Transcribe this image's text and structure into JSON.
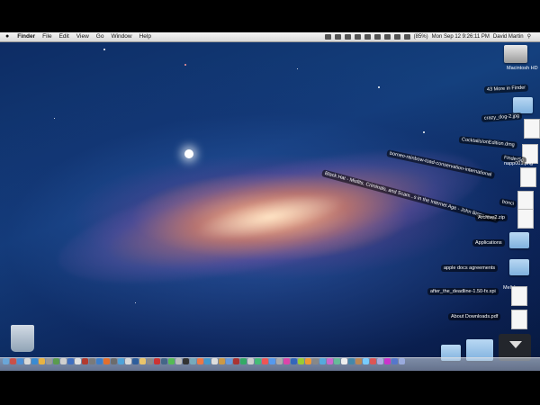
{
  "menubar": {
    "apple": "",
    "items": [
      "Finder",
      "File",
      "Edit",
      "View",
      "Go",
      "Window",
      "Help"
    ],
    "battery": "(85%)",
    "clock": "Mon Sep 12  9:26:11 PM",
    "user": "David Martin"
  },
  "desktop": {
    "disk_label": "Macintosh HD"
  },
  "downloads_stack": {
    "header": "43 More in Finder",
    "items": [
      "crazy_dog-2.jpg",
      "CocktailsIonEdition.dmg",
      "FinderSc",
      "napp001.png",
      "borneo-rainbow-toad-conservation-international",
      "Black Hat - Misfits, Criminals, and Scam...s in the Internet Age - John Biggs.epub",
      "bonci",
      "Archive2.zip",
      "Applications",
      "apple docs agreements",
      "Meltdown",
      "after_the_deadline-1.50-fx.xpi",
      "About Downloads.pdf"
    ]
  },
  "colors": {
    "accent_folder": "#8fbbe5",
    "menubar_bg": "#e6e6e6"
  }
}
